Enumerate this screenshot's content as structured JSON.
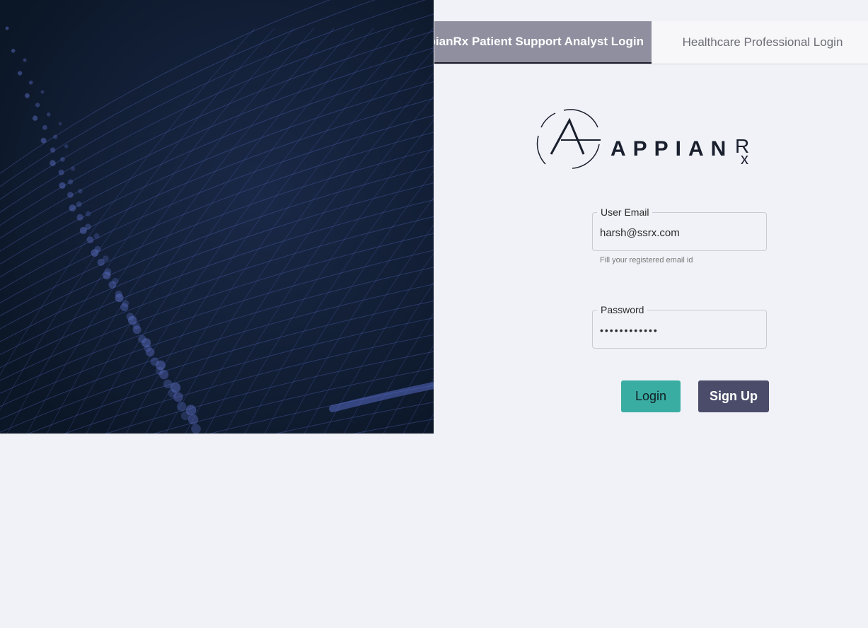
{
  "tabs": {
    "analyst_label": "pianRx Patient Support Analyst Login",
    "professional_label": "Healthcare Professional Login"
  },
  "logo": {
    "text": "APPIAN",
    "mark": "Rx"
  },
  "form": {
    "email": {
      "label": "User Email",
      "value": "harsh@ssrx.com",
      "helper": "Fill your registered email id"
    },
    "password": {
      "label": "Password",
      "value": "••••••••••••"
    }
  },
  "buttons": {
    "login": "Login",
    "signup": "Sign Up"
  },
  "colors": {
    "background": "#f1f2f7",
    "hero": "#0d1b2d",
    "active_tab": "#8f8fa0",
    "login_button": "#3aada3",
    "signup_button": "#4a4c6a"
  }
}
